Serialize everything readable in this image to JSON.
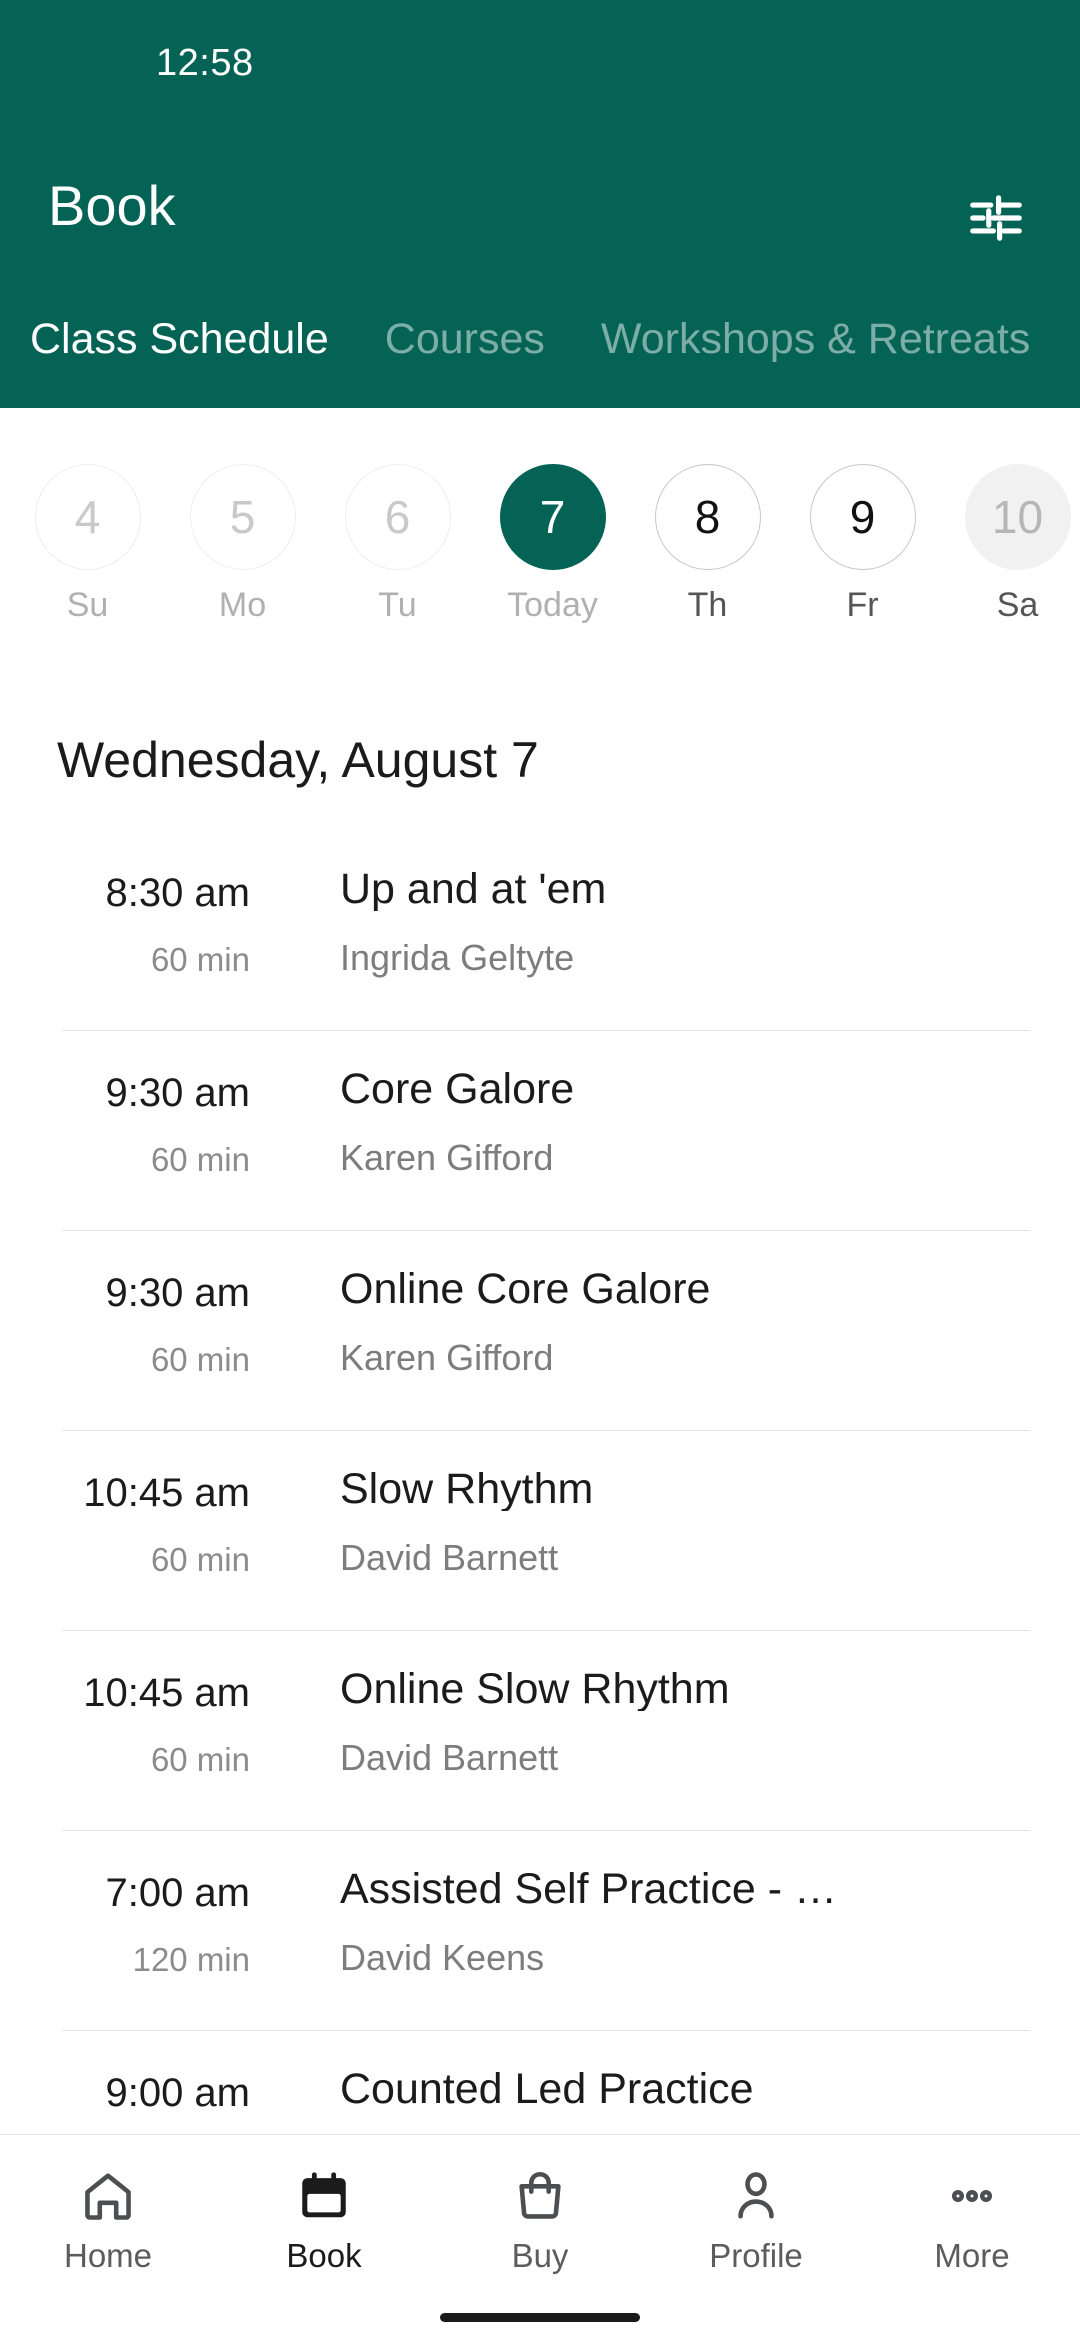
{
  "colors": {
    "brand_green": "#056355",
    "text_primary": "#1b1b1b",
    "text_muted": "#7d7d7d",
    "divider": "#e4e4e4"
  },
  "status_bar": {
    "time": "12:58"
  },
  "header": {
    "title": "Book",
    "filter_icon": "tune-sliders-icon"
  },
  "tabs": [
    {
      "label": "Class Schedule",
      "active": true
    },
    {
      "label": "Courses",
      "active": false
    },
    {
      "label": "Workshops & Retreats",
      "active": false
    }
  ],
  "date_strip": [
    {
      "num": "4",
      "day": "Su",
      "state": "past"
    },
    {
      "num": "5",
      "day": "Mo",
      "state": "past"
    },
    {
      "num": "6",
      "day": "Tu",
      "state": "past"
    },
    {
      "num": "7",
      "day": "Today",
      "state": "today"
    },
    {
      "num": "8",
      "day": "Th",
      "state": "future"
    },
    {
      "num": "9",
      "day": "Fr",
      "state": "future"
    },
    {
      "num": "10",
      "day": "Sa",
      "state": "filled"
    }
  ],
  "schedule": {
    "date_heading": "Wednesday, August 7",
    "classes": [
      {
        "time": "8:30 am",
        "duration": "60 min",
        "title": "Up and at 'em",
        "teacher": "Ingrida Geltyte"
      },
      {
        "time": "9:30 am",
        "duration": "60 min",
        "title": "Core Galore",
        "teacher": "Karen Gifford"
      },
      {
        "time": "9:30 am",
        "duration": "60 min",
        "title": "Online Core Galore",
        "teacher": "Karen Gifford"
      },
      {
        "time": "10:45 am",
        "duration": "60 min",
        "title": "Slow Rhythm",
        "teacher": "David Barnett"
      },
      {
        "time": "10:45 am",
        "duration": "60 min",
        "title": "Online Slow Rhythm",
        "teacher": "David Barnett"
      },
      {
        "time": "7:00 am",
        "duration": "120 min",
        "title": "Assisted Self Practice - …",
        "teacher": "David Keens"
      },
      {
        "time": "9:00 am",
        "duration": "",
        "title": "Counted Led Practice",
        "teacher": ""
      }
    ]
  },
  "bottom_nav": [
    {
      "label": "Home",
      "icon": "home-icon",
      "active": false
    },
    {
      "label": "Book",
      "icon": "calendar-icon",
      "active": true
    },
    {
      "label": "Buy",
      "icon": "bag-icon",
      "active": false
    },
    {
      "label": "Profile",
      "icon": "person-icon",
      "active": false
    },
    {
      "label": "More",
      "icon": "ellipsis-icon",
      "active": false
    }
  ]
}
